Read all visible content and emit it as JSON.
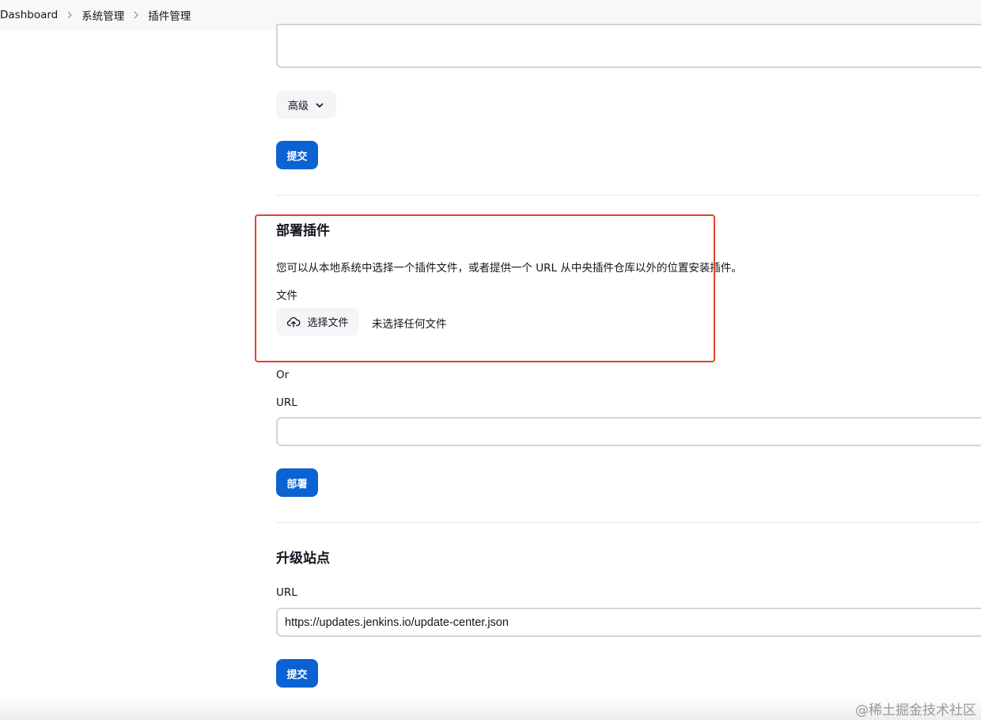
{
  "breadcrumb": {
    "items": [
      "Dashboard",
      "系统管理",
      "插件管理"
    ]
  },
  "advanced_section": {
    "advanced_label": "高级",
    "submit_label": "提交"
  },
  "deploy_plugin": {
    "title": "部署插件",
    "description": "您可以从本地系统中选择一个插件文件，或者提供一个 URL 从中央插件仓库以外的位置安装插件。",
    "file_label": "文件",
    "choose_file_label": "选择文件",
    "file_status": "未选择任何文件",
    "or_label": "Or",
    "url_label": "URL",
    "url_value": "",
    "deploy_label": "部署"
  },
  "update_site": {
    "title": "升级站点",
    "url_label": "URL",
    "url_value": "https://updates.jenkins.io/update-center.json",
    "submit_label": "提交"
  },
  "watermark": "@稀土掘金技术社区",
  "colors": {
    "primary": "#0b62d2",
    "highlight": "#e7412f",
    "breadcrumb_bg": "#f8f8f8",
    "secondary_button_bg": "#f5f5f7"
  },
  "icons": {
    "breadcrumb_separator": "chevron-right-icon",
    "advanced_toggle": "chevron-down-icon",
    "file_upload": "cloud-upload-icon"
  }
}
